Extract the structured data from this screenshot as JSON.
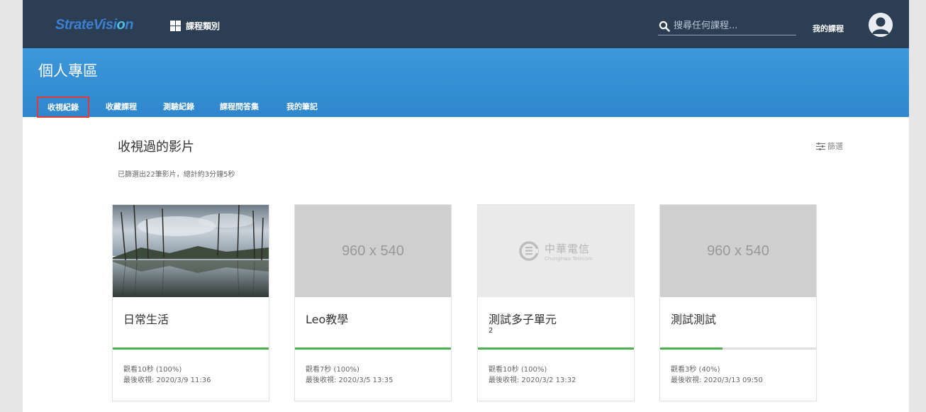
{
  "header": {
    "logo_text": "StrateVisi",
    "logo_o": "o",
    "logo_tail": "n",
    "categories_label": "課程類別",
    "search_placeholder": "搜尋任何課程...",
    "my_courses_label": "我的課程",
    "logo_color": "#3a7fd0",
    "topbar_color": "#2c3e54"
  },
  "banner": {
    "title": "個人專區",
    "color": "#3a93d8",
    "tabs": [
      {
        "label": "收視紀錄",
        "active": true
      },
      {
        "label": "收藏課程",
        "active": false
      },
      {
        "label": "測驗紀錄",
        "active": false
      },
      {
        "label": "課程問答集",
        "active": false
      },
      {
        "label": "我的筆記",
        "active": false
      }
    ]
  },
  "content": {
    "title": "收視過的影片",
    "subtitle": "已篩選出22筆影片，總計約3分鐘5秒",
    "filter_label": "篩選",
    "filter_icon": "filter-icon"
  },
  "cards": [
    {
      "title": "日常生活",
      "thumb": "photo",
      "sub": "",
      "watch": "觀看10秒 (100%)",
      "last": "最後收視: 2020/3/9 11:36",
      "progress": 1.0
    },
    {
      "title": "Leo教學",
      "thumb": "placeholder",
      "placeholder_text": "960 x 540",
      "sub": "",
      "watch": "觀看7秒 (100%)",
      "last": "最後收視: 2020/3/5 13:35",
      "progress": 1.0
    },
    {
      "title": "測試多子單元",
      "thumb": "logo",
      "logo_zh": "中華電信",
      "logo_en": "Chunghwa Telecom",
      "sub": "2",
      "watch": "觀看10秒 (100%)",
      "last": "最後收視: 2020/3/2 13:32",
      "progress": 1.0
    },
    {
      "title": "測試測試",
      "thumb": "placeholder",
      "placeholder_text": "960 x 540",
      "sub": "",
      "watch": "觀看3秒 (40%)",
      "last": "最後收視: 2020/3/13 09:50",
      "progress": 0.4
    }
  ],
  "colors": {
    "progress": "#4caf50",
    "active_tab_border": "#e53935"
  }
}
